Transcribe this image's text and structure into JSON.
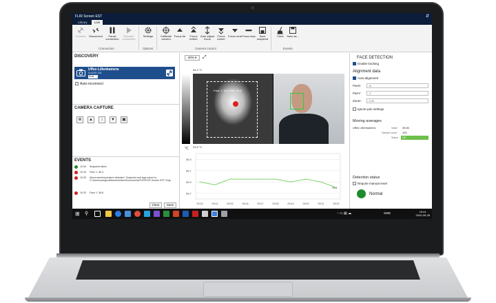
{
  "app": {
    "title": "FLIR Screen EST"
  },
  "tabs": [
    {
      "label": "Library"
    },
    {
      "label": "Live"
    }
  ],
  "ribbon": {
    "connection": {
      "label": "Connection",
      "connect": "Connect",
      "disconnect": "Disconnect",
      "pause": "Pause connection",
      "resume": "Resume connection"
    },
    "options": {
      "label": "Options",
      "settings": "Settings"
    },
    "camera_control": {
      "label": "Camera control",
      "calibrate": "Calibrate camera",
      "focus_far": "Focus far",
      "focus_further": "Focus further",
      "auto_focus": "Auto adjust focus",
      "focus_nearer": "Focus nearer",
      "focus_near": "Focus near",
      "focus_stop": "Focus stop",
      "save_snapshot": "Save snapshot"
    },
    "events": {
      "label": "Events",
      "clear": "Clear",
      "save_as": "Save as..."
    }
  },
  "discovery": {
    "title": "DISCOVERY",
    "camera_name": "Uffes Lillenkamera",
    "camera_id": "i1a1551 108",
    "camera_mode": "Dual",
    "auto_reconnect": "Auto-reconnect"
  },
  "camera_capture": {
    "title": "CAMERA CAPTURE"
  },
  "events": {
    "title": "EVENTS",
    "rows": [
      {
        "time": "10:34",
        "message": "Snapshot taken",
        "status": "ok"
      },
      {
        "time": "10:33",
        "message": "Face 1: 36.4",
        "status": "alarm"
      },
      {
        "time": "10:33",
        "message": "Abnormal temperature detected. Snapshot and logs saved to: C:\\Users\\uwegerold\\work\\folders\\Documents\\FLIR\\FLIR Screen EST Outp",
        "status": "alarm"
      },
      {
        "time": "10:33",
        "message": "Face 1: 36.8",
        "status": "alarm"
      }
    ],
    "clear": "Clear",
    "save": "Save"
  },
  "viewer": {
    "zoom": "40%",
    "scale_max": "34.4 °C",
    "scale_min": "21.5 °C",
    "spot_label": "Face 1: 36.4",
    "spot_value": "Max: 35.8",
    "graph_unit": "°C",
    "graph_y_ticks": [
      "36.3",
      "36.1",
      "35.9",
      "35.7"
    ],
    "graph_x_ticks": [
      "09:13",
      "09:14",
      "09:15",
      "09:16",
      "09:17",
      "09:18",
      "09:19",
      "09:20",
      "09:21",
      "09:22"
    ],
    "graph_last_value": "35.8"
  },
  "chart_data": {
    "type": "line",
    "x": [
      "09:13",
      "09:14",
      "09:15",
      "09:16",
      "09:17",
      "09:18",
      "09:19",
      "09:20",
      "09:21",
      "09:22"
    ],
    "series": [
      {
        "values": [
          35.9,
          35.85,
          35.95,
          35.95,
          35.95,
          35.95,
          35.9,
          35.95,
          35.9,
          35.8
        ]
      }
    ],
    "ylim": [
      35.6,
      36.4
    ]
  },
  "face_detection": {
    "title": "FACE DETECTION",
    "enable_tracking": "Enable tracking",
    "alignment_data": "Alignment data",
    "auto_alignment": "Auto-alignment",
    "panx_label": "PanX:",
    "panx_value": "-8",
    "pany_label": "PanY:",
    "pany_value": "-2",
    "zoom_label": "Zoom:",
    "zoom_value": "1.03",
    "ignore_pan": "Ignore pan settings",
    "moving_averages": "Moving averages",
    "avg_name": "Uffes Lillenkamera",
    "value_label": "Value",
    "value": "35.84",
    "sample_count_label": "Sample count",
    "sample_count": "100",
    "status_label": "Status",
    "status_value": "OK",
    "detection_status": "Detection status",
    "require_reset": "Require manual reset",
    "normal": "Normal"
  },
  "taskbar": {
    "time": "10:41",
    "date": "2020-05-28",
    "lang": "SWE"
  },
  "colors": {
    "titlebar": "#0b1d3a",
    "accent": "#1f4e8c",
    "ok": "#1e8b2d",
    "alarm": "#d42020",
    "graph_line": "#7ed36b"
  }
}
